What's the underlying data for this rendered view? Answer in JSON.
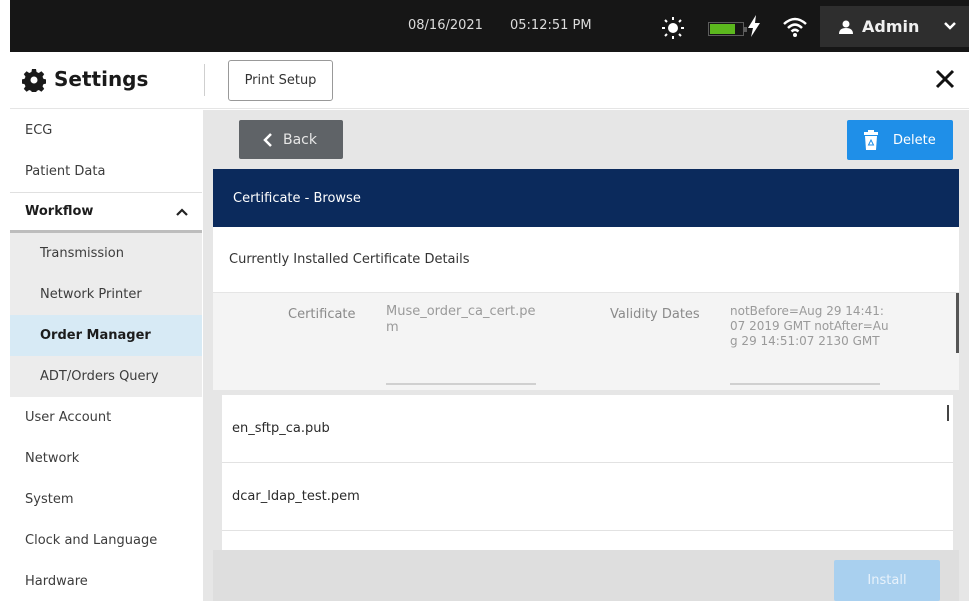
{
  "status_bar": {
    "date": "08/16/2021",
    "time": "05:12:51 PM",
    "battery_level_percent": 80,
    "battery_color": "#5cb81e",
    "user": "Admin"
  },
  "header": {
    "title": "Settings",
    "print_setup_label": "Print Setup"
  },
  "sidebar": {
    "items": [
      {
        "label": "ECG"
      },
      {
        "label": "Patient Data"
      },
      {
        "label": "Workflow"
      },
      {
        "label": "Transmission"
      },
      {
        "label": "Network Printer"
      },
      {
        "label": "Order Manager"
      },
      {
        "label": "ADT/Orders Query"
      },
      {
        "label": "User Account"
      },
      {
        "label": "Network"
      },
      {
        "label": "System"
      },
      {
        "label": "Clock and Language"
      },
      {
        "label": "Hardware"
      }
    ],
    "active_item": "Order Manager"
  },
  "main": {
    "back_label": "Back",
    "delete_label": "Delete",
    "panel_title": "Certificate - Browse",
    "details_title": "Currently Installed Certificate Details",
    "details": {
      "certificate_label": "Certificate",
      "certificate_value": "Muse_order_ca_cert.pem",
      "validity_label": "Validity Dates",
      "validity_value": "notBefore=Aug 29 14:41:07 2019 GMT notAfter=Aug 29 14:51:07 2130 GMT"
    },
    "certificates": [
      {
        "name": "en_sftp_ca.pub"
      },
      {
        "name": "dcar_ldap_test.pem"
      }
    ],
    "install_label": "Install"
  },
  "colors": {
    "status_bar_bg": "#161616",
    "panel_header_bg": "#0b2a5c",
    "delete_button_bg": "#1f8fe8",
    "install_button_bg": "#a9d0ef",
    "active_nav_bg": "#d7eaf5",
    "back_button_bg": "#5f6367"
  }
}
